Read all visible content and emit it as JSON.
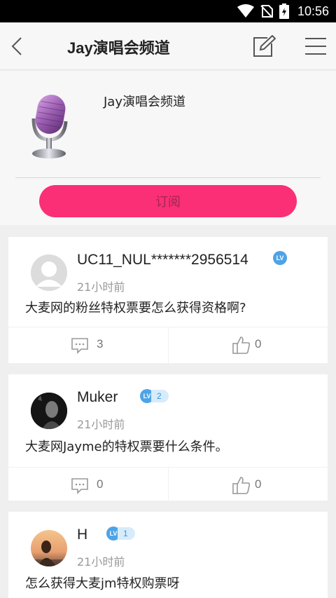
{
  "status_bar": {
    "time": "10:56"
  },
  "navbar": {
    "title": "Jay演唱会频道"
  },
  "channel": {
    "name": "Jay演唱会频道",
    "subscribe_label": "订阅"
  },
  "posts": [
    {
      "username": "UC11_NUL*******2956514",
      "level_badge": "LV",
      "level": "",
      "time": "21小时前",
      "text": "大麦网的粉丝特权票要怎么获得资格啊?",
      "comments": "3",
      "likes": "0"
    },
    {
      "username": "Muker",
      "level_badge": "LV",
      "level": "2",
      "time": "21小时前",
      "text": "大麦网Jayme的特权票要什么条件。",
      "comments": "0",
      "likes": "0"
    },
    {
      "username": "H",
      "level_badge": "LV",
      "level": "1",
      "time": "21小时前",
      "text": "怎么获得大麦jm特权购票呀"
    }
  ],
  "colors": {
    "accent": "#fb2f75",
    "badge": "#4ea3e6",
    "background": "#efefef"
  }
}
